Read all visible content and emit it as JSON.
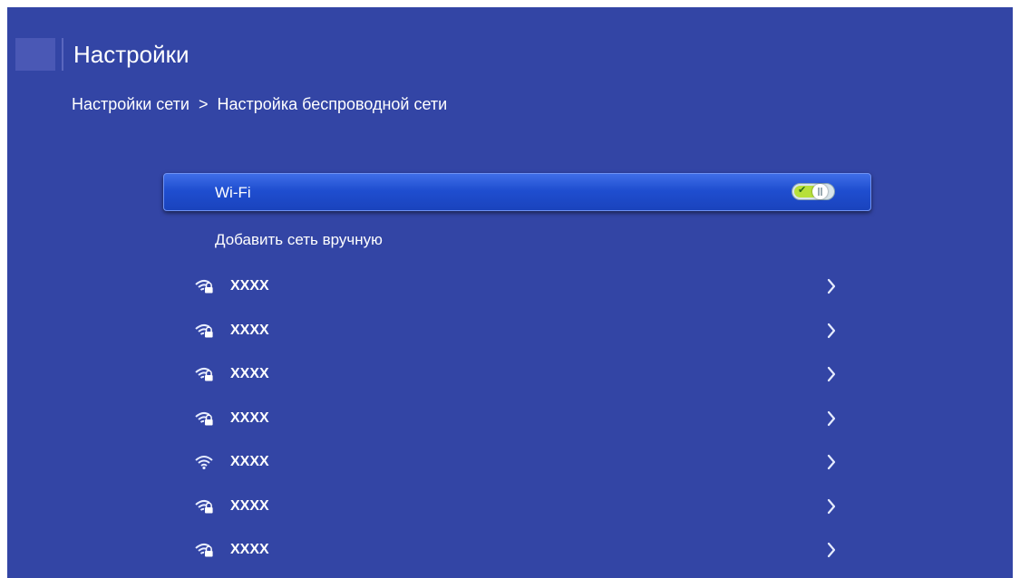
{
  "header": {
    "title": "Настройки"
  },
  "breadcrumb": {
    "parent": "Настройки сети",
    "separator": ">",
    "current": "Настройка беспроводной сети"
  },
  "wifi": {
    "label": "Wi-Fi",
    "toggle_on": true,
    "check_glyph": "✔"
  },
  "add_network": {
    "label": "Добавить сеть вручную"
  },
  "networks": [
    {
      "name": "XXXX",
      "icon": "wifi-lock-icon"
    },
    {
      "name": "XXXX",
      "icon": "wifi-lock-icon"
    },
    {
      "name": "XXXX",
      "icon": "wifi-lock-icon"
    },
    {
      "name": "XXXX",
      "icon": "wifi-lock-icon"
    },
    {
      "name": "XXXX",
      "icon": "wifi-icon"
    },
    {
      "name": "XXXX",
      "icon": "wifi-lock-icon"
    },
    {
      "name": "XXXX",
      "icon": "wifi-lock-icon"
    }
  ],
  "colors": {
    "background": "#3345a5",
    "highlight": "#1f4ed0",
    "toggle_on": "#b7e03a"
  }
}
